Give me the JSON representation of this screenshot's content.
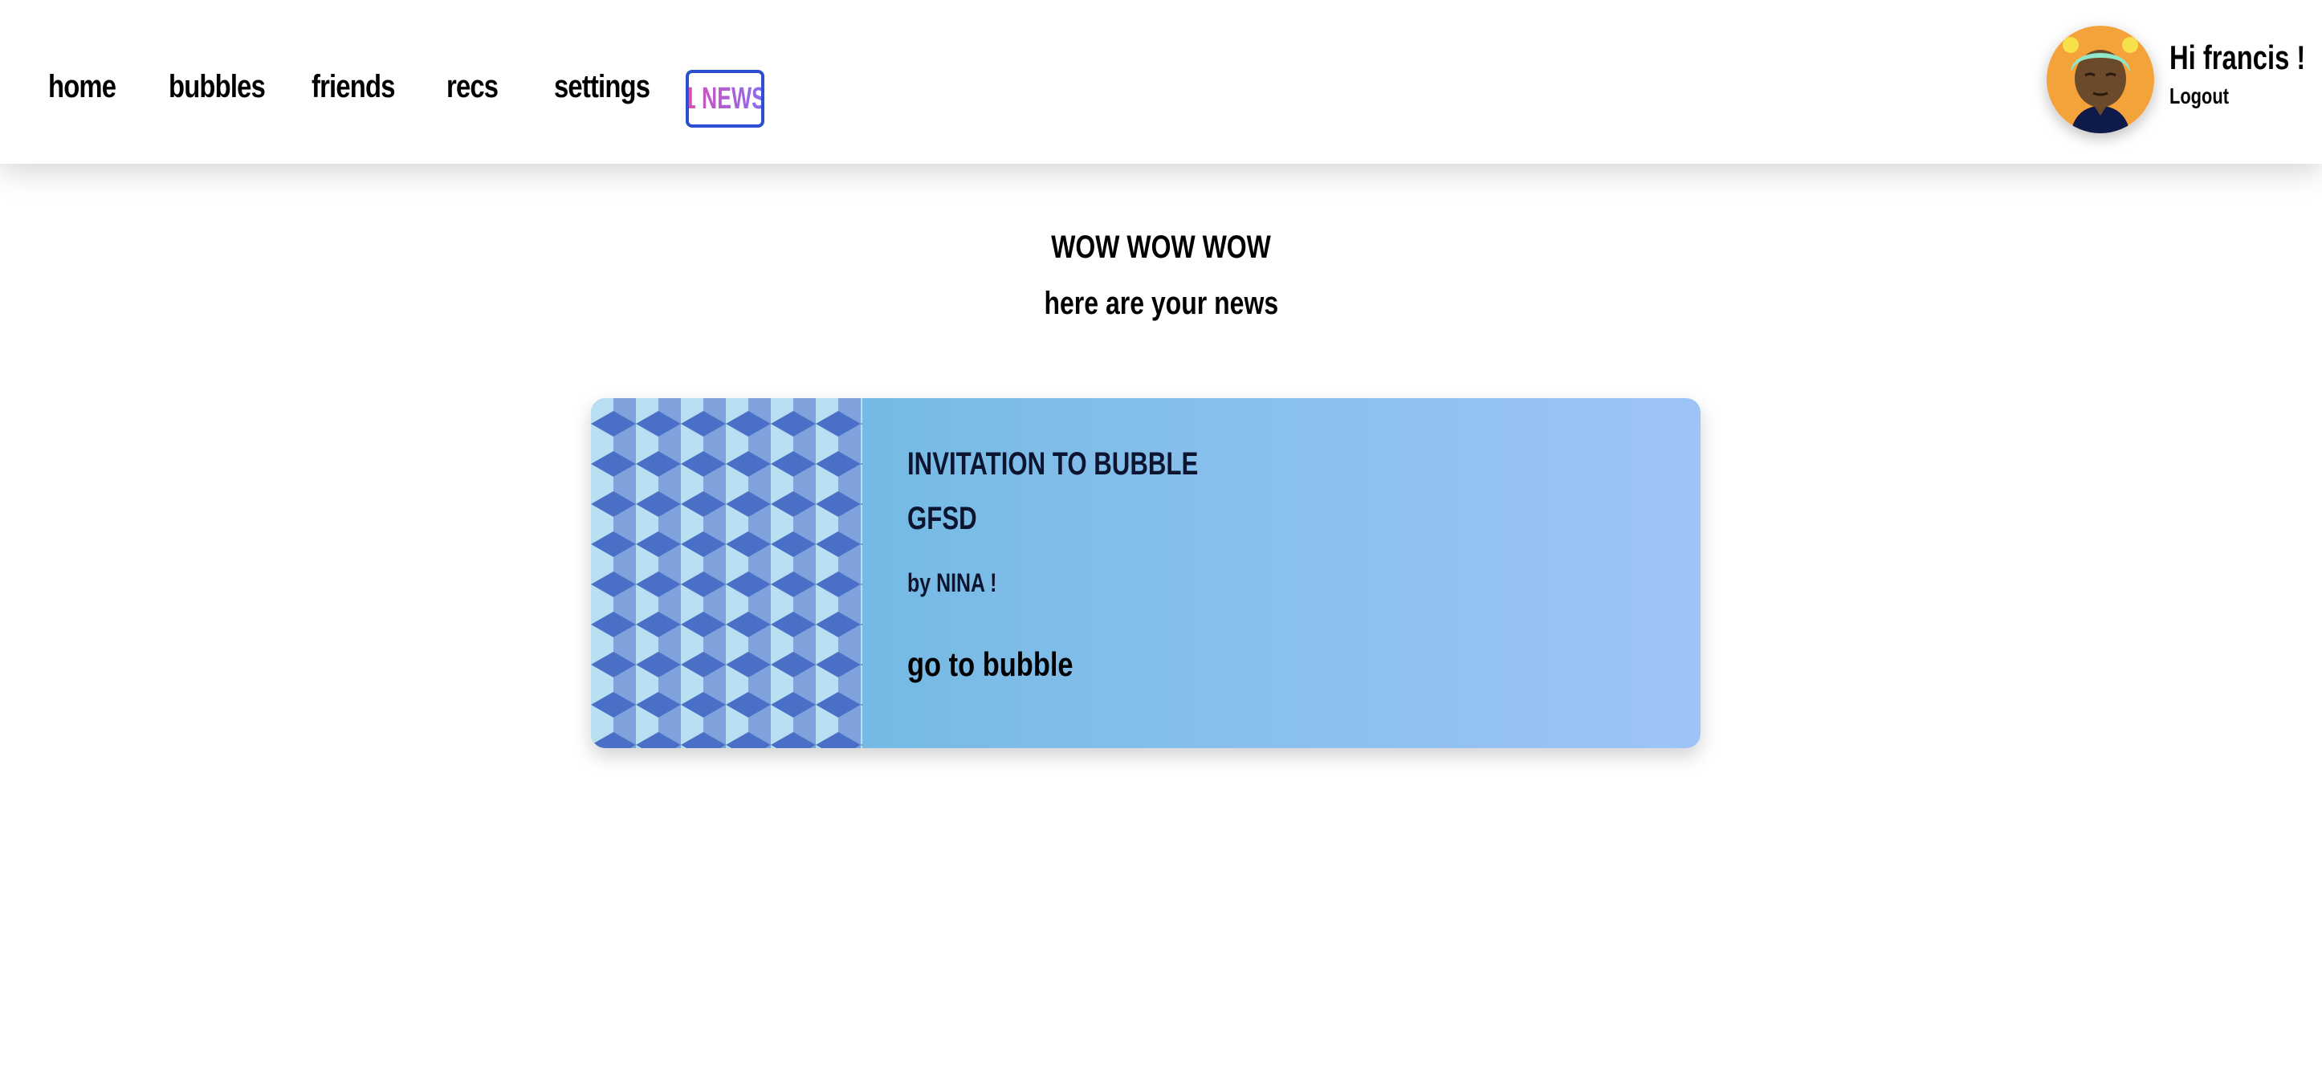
{
  "nav": {
    "links": [
      "home",
      "bubbles",
      "friends",
      "recs",
      "settings"
    ],
    "news_label": "1 NEWS"
  },
  "user": {
    "greeting": "Hi francis !",
    "logout_label": "Logout"
  },
  "main": {
    "headline": "WOW WOW WOW",
    "subheadline": "here are your news"
  },
  "news_card": {
    "title": "INVITATION TO BUBBLE",
    "bubble_name": "GFSD",
    "by": "by NINA !",
    "link_label": "go to bubble"
  },
  "colors": {
    "news_border": "#2b4fd1",
    "news_text_start": "#d84fb4",
    "news_text_end": "#8b6cf0",
    "card_gradient_start": "#63b6dd",
    "card_gradient_end": "#9ec4f7",
    "avatar_bg": "#f4a23a"
  },
  "icons": {
    "decline": "close-icon",
    "accept": "check-icon"
  }
}
